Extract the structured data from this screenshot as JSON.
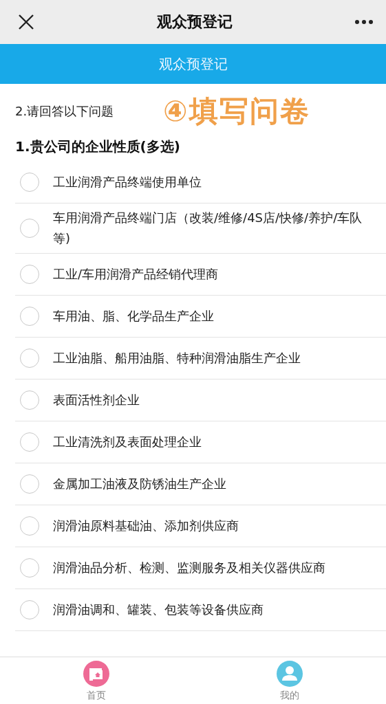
{
  "nav_bar": {
    "title": "观众预登记"
  },
  "header_banner": {
    "title": "观众预登记"
  },
  "section_label": "2.请回答以下问题",
  "annotation": "④填写问卷",
  "question": {
    "title": "1.贵公司的企业性质(多选)",
    "options": [
      {
        "label": "工业润滑产品终端使用单位",
        "checked": false
      },
      {
        "label": "车用润滑产品终端门店（改装/维修/4S店/快修/养护/车队等)",
        "checked": false
      },
      {
        "label": "工业/车用润滑产品经销代理商",
        "checked": false
      },
      {
        "label": "车用油、脂、化学品生产企业",
        "checked": false
      },
      {
        "label": "工业油脂、船用油脂、特种润滑油脂生产企业",
        "checked": false
      },
      {
        "label": "表面活性剂企业",
        "checked": false
      },
      {
        "label": "工业清洗剂及表面处理企业",
        "checked": false
      },
      {
        "label": "金属加工油液及防锈油生产企业",
        "checked": false
      },
      {
        "label": "润滑油原料基础油、添加剂供应商",
        "checked": false
      },
      {
        "label": "润滑油品分析、检测、监测服务及相关仪器供应商",
        "checked": false
      },
      {
        "label": "润滑油调和、罐装、包装等设备供应商",
        "checked": false
      }
    ]
  },
  "tab_bar": [
    {
      "label": "首页",
      "kind": "home",
      "selected": false
    },
    {
      "label": "我的",
      "kind": "profile",
      "selected": false
    }
  ]
}
